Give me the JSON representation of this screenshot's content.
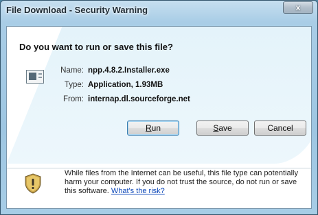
{
  "window": {
    "title": "File Download - Security Warning",
    "close_label": "x"
  },
  "dialog": {
    "question": "Do you want to run or save this file?",
    "file": {
      "name_label": "Name:",
      "name_value": "npp.4.8.2.Installer.exe",
      "type_label": "Type:",
      "type_value": "Application, 1.93MB",
      "from_label": "From:",
      "from_value": "internap.dl.sourceforge.net"
    },
    "buttons": {
      "run_first": "R",
      "run_rest": "un",
      "save_first": "S",
      "save_rest": "ave",
      "cancel": "Cancel"
    },
    "warning": {
      "text": "While files from the Internet can be useful, this file type can potentially harm your computer. If you do not trust the source, do not run or save this software. ",
      "link": "What's the risk?"
    }
  },
  "icons": {
    "file": "application-file-icon",
    "warning": "security-shield-icon"
  },
  "colors": {
    "link": "#0b46b8",
    "accent_bg": "#e4f3fa",
    "titlebar": "#a9cde6"
  }
}
